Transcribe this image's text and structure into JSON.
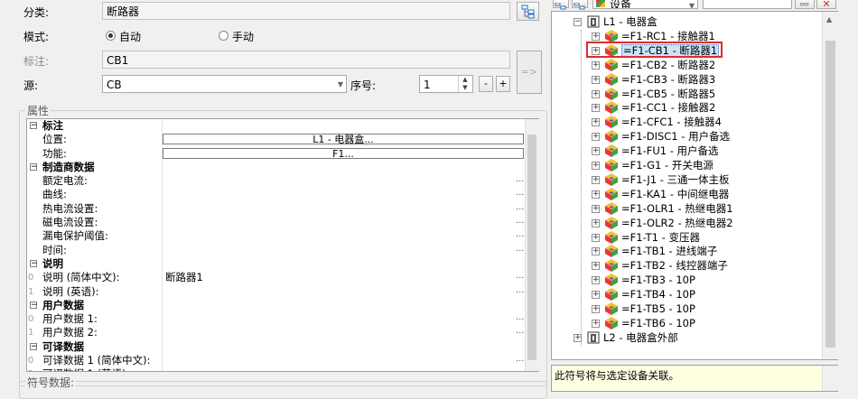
{
  "form": {
    "category_label": "分类:",
    "category_value": "断路器",
    "mode_label": "模式:",
    "mode_auto": "自动",
    "mode_manual": "手动",
    "tag_label": "标注:",
    "tag_value": "CB1",
    "source_label": "源:",
    "source_value": "CB",
    "seq_label": "序号:",
    "seq_value": "1",
    "minus": "-",
    "plus": "+",
    "apply_label": "=>"
  },
  "properties": {
    "group_title": "属性",
    "rows": [
      {
        "type": "grp",
        "key": "标注",
        "toggle": "−"
      },
      {
        "type": "item",
        "key": "位置:",
        "box": "L1 - 电器盒..."
      },
      {
        "type": "item",
        "key": "功能:",
        "box": "F1..."
      },
      {
        "type": "grp",
        "key": "制造商数据",
        "toggle": "−"
      },
      {
        "type": "item",
        "key": "额定电流:",
        "dots": "..."
      },
      {
        "type": "item",
        "key": "曲线:",
        "dots": "..."
      },
      {
        "type": "item",
        "key": "热电流设置:",
        "dots": "..."
      },
      {
        "type": "item",
        "key": "磁电流设置:",
        "dots": "..."
      },
      {
        "type": "item",
        "key": "漏电保护阈值:",
        "dots": "..."
      },
      {
        "type": "item",
        "key": "时间:",
        "dots": "..."
      },
      {
        "type": "grp",
        "key": "说明",
        "toggle": "−"
      },
      {
        "type": "item",
        "num": "0",
        "key": "说明 (简体中文):",
        "value": "断路器1",
        "dots": "..."
      },
      {
        "type": "item",
        "num": "1",
        "key": "说明 (英语):",
        "dots": "..."
      },
      {
        "type": "grp",
        "key": "用户数据",
        "toggle": "−"
      },
      {
        "type": "item",
        "num": "0",
        "key": "用户数据 1:",
        "dots": "..."
      },
      {
        "type": "item",
        "num": "1",
        "key": "用户数据 2:",
        "dots": "..."
      },
      {
        "type": "grp",
        "key": "可译数据",
        "toggle": "−"
      },
      {
        "type": "item",
        "num": "0",
        "key": "可译数据 1 (简体中文):",
        "dots": "..."
      },
      {
        "type": "item",
        "num": "1",
        "key": "可译数据 1 (英语):",
        "dots": "..."
      },
      {
        "type": "item",
        "num": "2",
        "key": "可译数据 2 (简体中文):",
        "dots": "..."
      }
    ]
  },
  "symbol_group_title": "符号数据:",
  "toolbar": {
    "filter_value": "设备"
  },
  "tree": {
    "root": {
      "label": "L1 - 电器盒",
      "toggle": "−"
    },
    "items": [
      "=F1-RC1 - 接触器1",
      "=F1-CB1 - 断路器1",
      "=F1-CB2 - 断路器2",
      "=F1-CB3 - 断路器3",
      "=F1-CB5 - 断路器5",
      "=F1-CC1 - 接触器2",
      "=F1-CFC1 - 接触器4",
      "=F1-DISC1 - 用户备选",
      "=F1-FU1 - 用户备选",
      "=F1-G1 - 开关电源",
      "=F1-J1 - 三通一体主板",
      "=F1-KA1 - 中间继电器",
      "=F1-OLR1 - 热继电器1",
      "=F1-OLR2 - 热继电器2",
      "=F1-T1 - 变压器",
      "=F1-TB1 - 进线端子",
      "=F1-TB2 - 线控器端子",
      "=F1-TB3 - 10P",
      "=F1-TB4 - 10P",
      "=F1-TB5 - 10P",
      "=F1-TB6 - 10P"
    ],
    "root2": {
      "label": "L2 - 电器盒外部",
      "toggle": "+"
    },
    "selected_index": 1,
    "item_toggle": "+"
  },
  "info_text": "此符号将与选定设备关联。",
  "colors": {
    "selection_box": "#e02b2b",
    "selected_bg": "#cce4f7",
    "info_bg": "#ffffe1"
  }
}
